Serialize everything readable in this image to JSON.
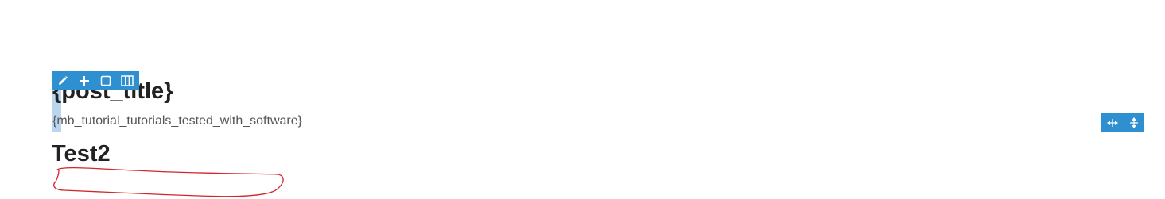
{
  "section": {
    "post_title": "{post_title}",
    "meta_field": "{mb_tutorial_tutorials_tested_with_software}",
    "toolbar": {
      "icons": [
        "pencil-icon",
        "plus-icon",
        "square-icon",
        "columns-icon"
      ]
    },
    "controls": {
      "icons": [
        "horizontal-resize-icon",
        "vertical-resize-icon"
      ]
    }
  },
  "content": {
    "heading": "Test2"
  },
  "colors": {
    "accent": "#2e8fd1",
    "strip": "#b9d6ee",
    "text": "#222222",
    "muted_text": "#555555",
    "annotation": "#d0262c"
  }
}
